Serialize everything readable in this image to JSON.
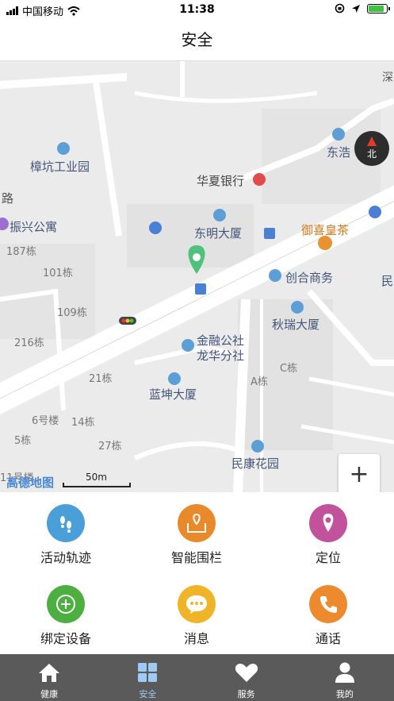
{
  "status_bar": {
    "carrier": "中国移动",
    "time": "11:38",
    "battery_level": 0.9
  },
  "header": {
    "title": "安全"
  },
  "map": {
    "labels": {
      "zhangkeng": "樟坑工业园",
      "huaxia": "华夏银行",
      "donghao": "东浩",
      "dongming": "东明大厦",
      "yuxi": "御喜皇茶",
      "zhenxing": "振兴公寓",
      "b187": "187栋",
      "b101": "101栋",
      "b109": "109栋",
      "b216": "216栋",
      "b21": "21栋",
      "b6": "6号楼",
      "b14": "14栋",
      "b5": "5栋",
      "b27": "27栋",
      "b11": "11号楼",
      "chuanghe": "创合商务",
      "min": "民",
      "qiurui": "秋瑞大厦",
      "jinrong1": "金融公社",
      "jinrong2": "龙华分社",
      "lankun": "蓝坤大厦",
      "ablock": "A栋",
      "cblock": "C栋",
      "minkang": "民康花园",
      "road": "路",
      "shen": "深",
      "logo": "高德地图",
      "scale": "50m"
    },
    "compass_label": "北",
    "zoom_in": "+",
    "zoom_out": "−"
  },
  "services": [
    {
      "label": "活动轨迹",
      "color": "#4a9fd9",
      "icon": "footprints-icon"
    },
    {
      "label": "智能围栏",
      "color": "#e8892a",
      "icon": "geofence-icon"
    },
    {
      "label": "定位",
      "color": "#c1529b",
      "icon": "location-pin-icon"
    },
    {
      "label": "绑定设备",
      "color": "#4caf3f",
      "icon": "plus-circle-icon"
    },
    {
      "label": "消息",
      "color": "#f0b428",
      "icon": "chat-bubble-icon"
    },
    {
      "label": "通话",
      "color": "#ec8a2d",
      "icon": "phone-icon"
    }
  ],
  "tabs": [
    {
      "label": "健康",
      "icon": "home-icon"
    },
    {
      "label": "安全",
      "icon": "grid-icon",
      "active": true
    },
    {
      "label": "服务",
      "icon": "heart-icon"
    },
    {
      "label": "我的",
      "icon": "user-icon"
    }
  ],
  "colors": {
    "tabbar_bg": "#5a5a5a",
    "active_tab": "#9fcaf5",
    "map_bg": "#ebebeb"
  }
}
